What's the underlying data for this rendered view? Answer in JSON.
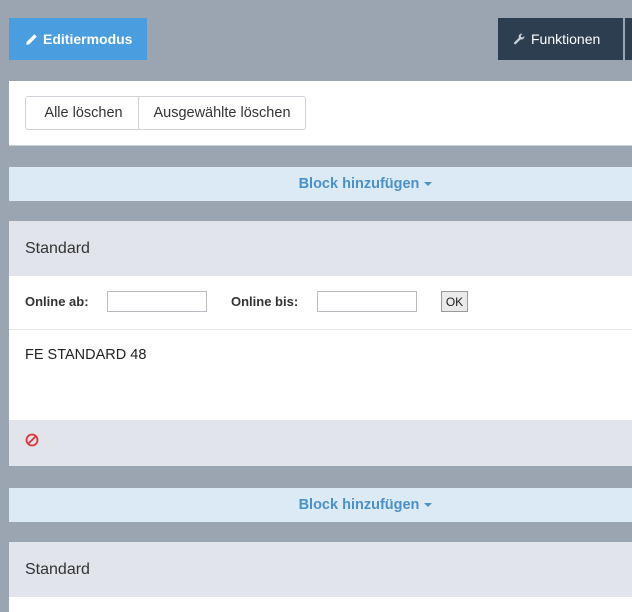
{
  "toolbar": {
    "edit_mode_label": "Editiermodus",
    "functions_label": "Funktionen"
  },
  "actions": {
    "delete_all_label": "Alle löschen",
    "delete_selected_label": "Ausgewählte löschen"
  },
  "add_block_label": "Block hinzufügen",
  "blocks": [
    {
      "title": "Standard",
      "online_from_label": "Online ab:",
      "online_from_value": "",
      "online_to_label": "Online bis:",
      "online_to_value": "",
      "ok_label": "OK",
      "content": "FE STANDARD 48"
    },
    {
      "title": "Standard"
    }
  ],
  "colors": {
    "background": "#9ba5b1",
    "edit_mode": "#4a9ee0",
    "functions": "#2c3e50",
    "add_block_bg": "#dbeaf4",
    "add_block_text": "#4a90c9",
    "block_header": "#e1e4ea",
    "disable_icon": "#e0353a"
  }
}
